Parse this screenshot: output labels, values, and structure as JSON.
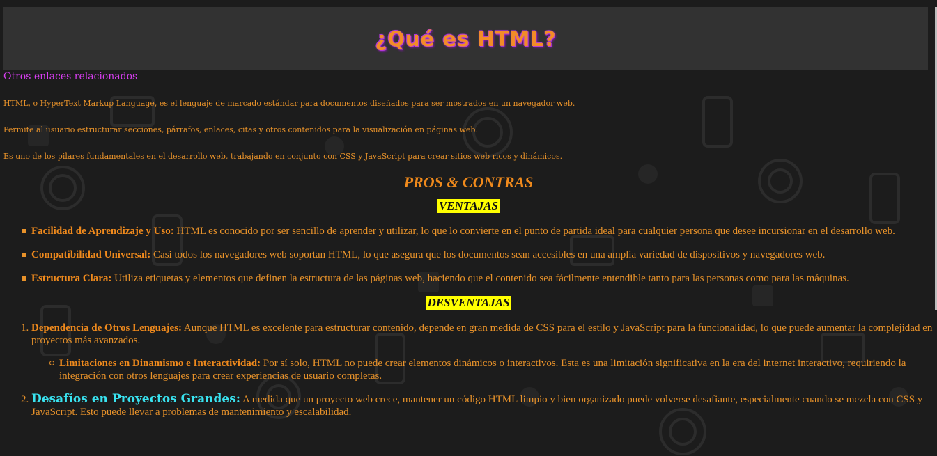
{
  "header": {
    "title": "¿Qué es HTML?"
  },
  "nav": {
    "related_link": "Otros enlaces relacionados"
  },
  "intro": [
    "HTML, o HyperText Markup Language, es el lenguaje de marcado estándar para documentos diseñados para ser mostrados en un navegador web.",
    "Permite al usuario estructurar secciones, párrafos, enlaces, citas y otros contenidos para la visualización en páginas web.",
    "Es uno de los pilares fundamentales en el desarrollo web, trabajando en conjunto con CSS y JavaScript para crear sitios web ricos y dinámicos."
  ],
  "section": {
    "title": "PROS & CONTRAS",
    "pros_heading": "VENTAJAS",
    "cons_heading": "DESVENTAJAS"
  },
  "pros": [
    {
      "lead": "Facilidad de Aprendizaje y Uso:",
      "text": " HTML es conocido por ser sencillo de aprender y utilizar, lo que lo convierte en el punto de partida ideal para cualquier persona que desee incursionar en el desarrollo web."
    },
    {
      "lead": "Compatibilidad Universal:",
      "text": " Casi todos los navegadores web soportan HTML, lo que asegura que los documentos sean accesibles en una amplia variedad de dispositivos y navegadores web."
    },
    {
      "lead": "Estructura Clara:",
      "text": " Utiliza etiquetas y elementos que definen la estructura de las páginas web, haciendo que el contenido sea fácilmente entendible tanto para las personas como para las máquinas."
    }
  ],
  "cons": [
    {
      "lead": "Dependencia de Otros Lenguajes:",
      "text": " Aunque HTML es excelente para estructurar contenido, depende en gran medida de CSS para el estilo y JavaScript para la funcionalidad, lo que puede aumentar la complejidad en proyectos más avanzados.",
      "sub": {
        "lead": "Limitaciones en Dinamismo e Interactividad:",
        "text": " Por sí solo, HTML no puede crear elementos dinámicos o interactivos. Esta es una limitación significativa en la era del internet interactivo, requiriendo la integración con otros lenguajes para crear experiencias de usuario completas."
      }
    },
    {
      "lead": "Desafíos en Proyectos Grandes:",
      "text": " A medida que un proyecto web crece, mantener un código HTML limpio y bien organizado puede volverse desafiante, especialmente cuando se mezcla con CSS y JavaScript. Esto puede llevar a problemas de mantenimiento y escalabilidad."
    }
  ],
  "colors": {
    "text": "#e8922a",
    "link": "#d73ef0",
    "highlight": "#ffff00",
    "accent_cyan": "#39e3f0",
    "banner": "#323232",
    "background": "#1c1c1c"
  }
}
